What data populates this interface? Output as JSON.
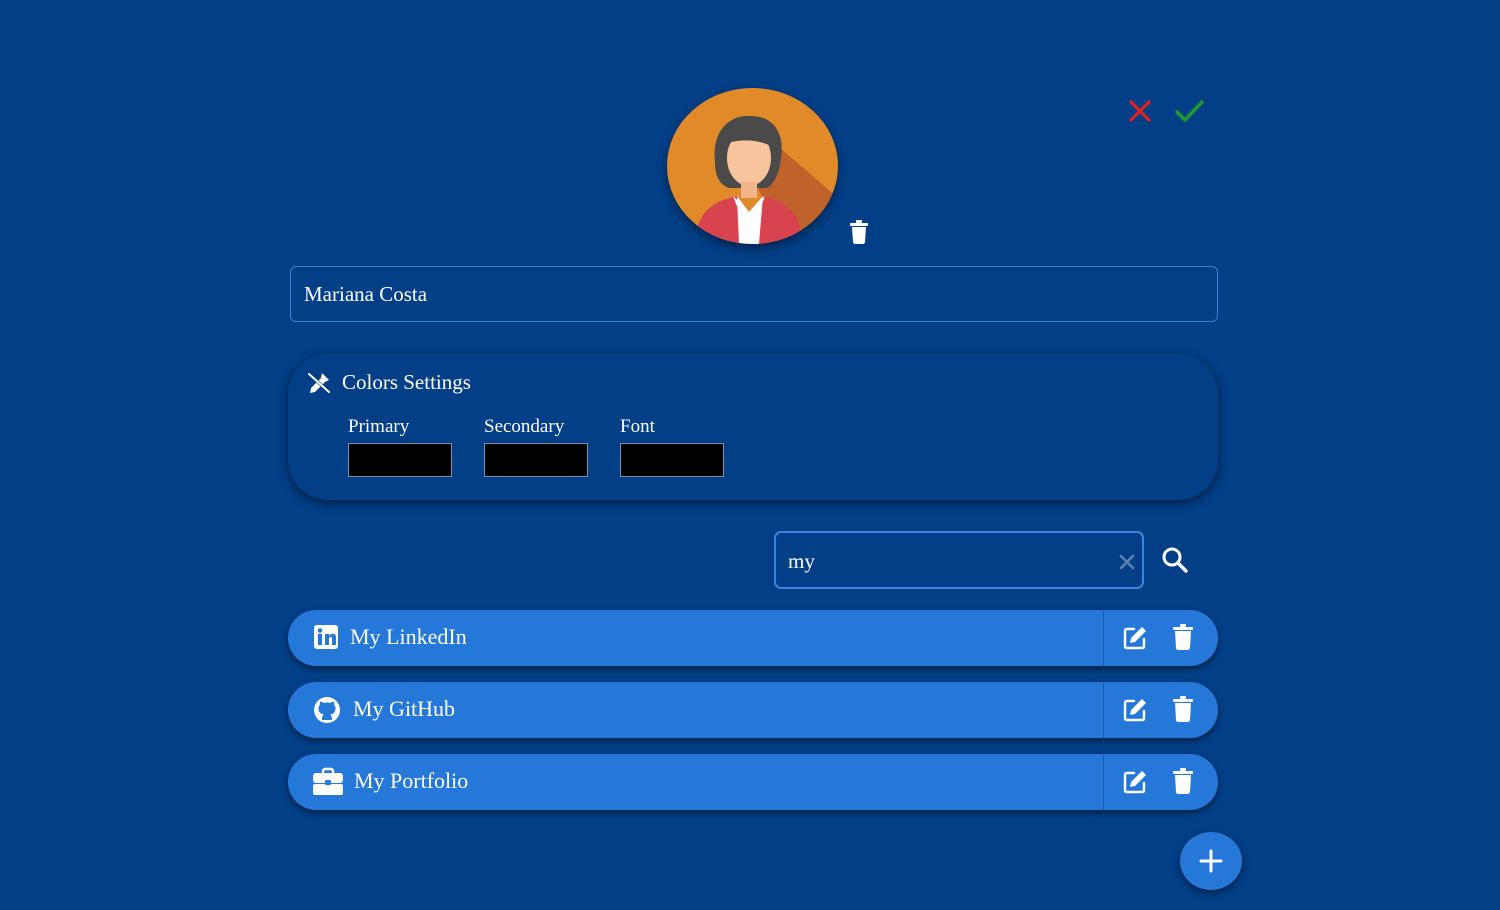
{
  "profile": {
    "name_value": "Mariana Costa",
    "avatar_icon": "person-avatar",
    "delete_avatar_icon": "trash-icon"
  },
  "header_actions": {
    "cancel_icon": "close-icon",
    "confirm_icon": "check-icon",
    "cancel_color": "#e0201f",
    "confirm_color": "#1d9a2e"
  },
  "colors_settings": {
    "title": "Colors Settings",
    "icon": "eyedropper-icon",
    "fields": [
      {
        "label": "Primary",
        "value": "#000000"
      },
      {
        "label": "Secondary",
        "value": "#000000"
      },
      {
        "label": "Font",
        "value": "#000000"
      }
    ]
  },
  "search": {
    "value": "my",
    "clear_icon": "close-icon",
    "search_icon": "search-icon"
  },
  "links": [
    {
      "label": "My LinkedIn",
      "icon": "linkedin-icon"
    },
    {
      "label": "My GitHub",
      "icon": "github-icon"
    },
    {
      "label": "My Portfolio",
      "icon": "briefcase-icon"
    }
  ],
  "add_button_icon": "plus-icon",
  "theme": {
    "background": "#023f87",
    "row": "#2577d8",
    "accent_border": "#3a84e0"
  }
}
